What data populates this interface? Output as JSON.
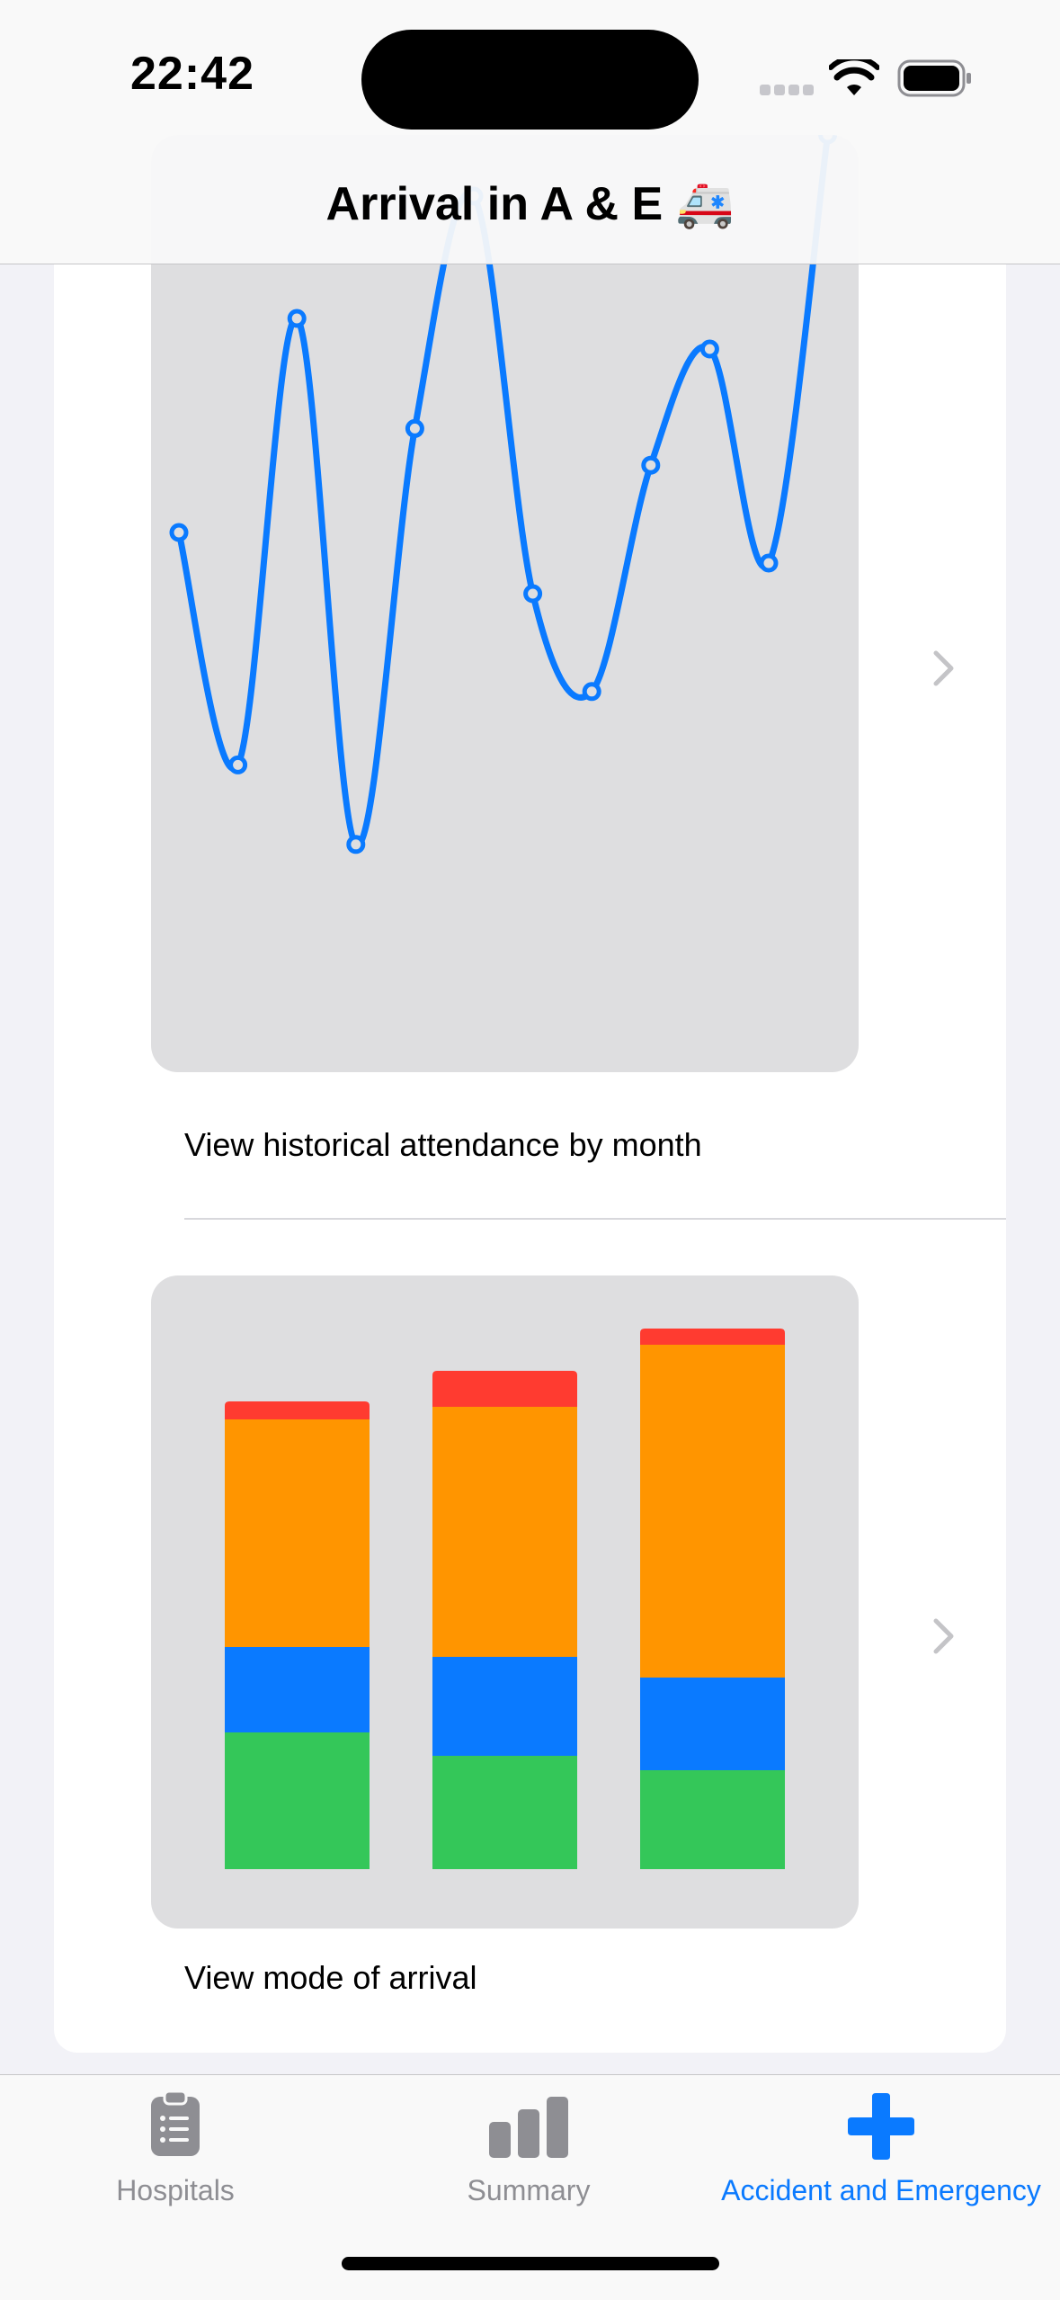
{
  "status_bar": {
    "time": "22:42"
  },
  "nav": {
    "title": "Arrival in A & E 🚑"
  },
  "rows": [
    {
      "label": "View historical attendance by month",
      "chevron": "chevron-right-icon"
    },
    {
      "label": "View mode of arrival",
      "chevron": "chevron-right-icon"
    }
  ],
  "chart_data": [
    {
      "type": "line",
      "x": [
        1,
        2,
        3,
        4,
        5,
        6,
        7,
        8,
        9,
        10,
        11,
        12
      ],
      "series": [
        {
          "values": [
            0.6,
            0.22,
            0.95,
            0.09,
            0.77,
            1.15,
            0.5,
            0.34,
            0.71,
            0.9,
            0.55,
            1.25
          ]
        }
      ],
      "color": "#0a7aff",
      "grid": false,
      "axes_visible": false,
      "note_values": "relative values, axes not shown"
    },
    {
      "type": "bar",
      "stacked": true,
      "categories": [
        "1",
        "2",
        "3"
      ],
      "series": [
        {
          "values": [
            152,
            126,
            110
          ],
          "color": "#34c759"
        },
        {
          "values": [
            95,
            110,
            103
          ],
          "color": "#0a7aff"
        },
        {
          "values": [
            253,
            278,
            370
          ],
          "color": "#ff9500"
        },
        {
          "values": [
            20,
            40,
            18
          ],
          "color": "#ff3b30"
        }
      ],
      "grid": false,
      "axes_visible": false
    }
  ],
  "tabs": [
    {
      "label": "Hospitals",
      "icon": "clipboard-icon",
      "active": false
    },
    {
      "label": "Summary",
      "icon": "bar-chart-icon",
      "active": false
    },
    {
      "label": "Accident and Emergency",
      "icon": "cross-icon",
      "active": true
    }
  ],
  "colors": {
    "accent": "#0a7aff",
    "inactive": "#8e8e93",
    "chart_background": "#dedee0"
  }
}
